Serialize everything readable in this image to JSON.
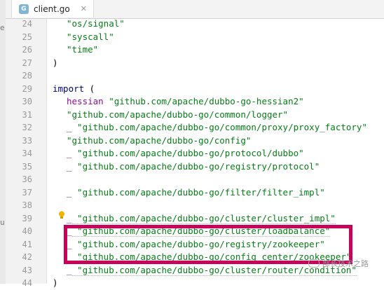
{
  "tab": {
    "filename": "client.go",
    "icon_name": "go-file-icon"
  },
  "editor": {
    "lines": [
      {
        "num": "24",
        "parts": [
          {
            "t": "\"os/signal\"",
            "c": "str"
          }
        ]
      },
      {
        "num": "25",
        "parts": [
          {
            "t": "\"syscall\"",
            "c": "str"
          }
        ]
      },
      {
        "num": "26",
        "parts": [
          {
            "t": "\"time\"",
            "c": "str"
          }
        ]
      },
      {
        "num": "27",
        "parts": [
          {
            "t": ")",
            "c": "punc"
          }
        ]
      },
      {
        "num": "28",
        "parts": []
      },
      {
        "num": "29",
        "parts": [
          {
            "t": "import",
            "c": "kw"
          },
          {
            "t": " (",
            "c": "punc"
          }
        ]
      },
      {
        "num": "30",
        "parts": [
          {
            "t": "hessian",
            "c": "alias"
          },
          {
            "t": " \"github.com/apache/dubbo-go-hessian2\"",
            "c": "str"
          }
        ]
      },
      {
        "num": "31",
        "parts": [
          {
            "t": "\"github.com/apache/dubbo-go/common/logger\"",
            "c": "str"
          }
        ]
      },
      {
        "num": "32",
        "parts": [
          {
            "t": "_",
            "c": "alias"
          },
          {
            "t": " \"github.com/apache/dubbo-go/common/proxy/proxy_factory\"",
            "c": "str"
          }
        ]
      },
      {
        "num": "33",
        "parts": [
          {
            "t": "\"github.com/apache/dubbo-go/config\"",
            "c": "str"
          }
        ]
      },
      {
        "num": "34",
        "parts": [
          {
            "t": "_",
            "c": "alias"
          },
          {
            "t": " \"github.com/apache/dubbo-go/protocol/dubbo\"",
            "c": "str"
          }
        ]
      },
      {
        "num": "35",
        "parts": [
          {
            "t": "_",
            "c": "alias"
          },
          {
            "t": " \"github.com/apache/dubbo-go/registry/protocol\"",
            "c": "str"
          }
        ]
      },
      {
        "num": "36",
        "parts": []
      },
      {
        "num": "37",
        "parts": [
          {
            "t": "_",
            "c": "alias"
          },
          {
            "t": " \"github.com/apache/dubbo-go/filter/filter_impl\"",
            "c": "str"
          }
        ]
      },
      {
        "num": "38",
        "parts": []
      },
      {
        "num": "39",
        "parts": [
          {
            "t": "_",
            "c": "alias"
          },
          {
            "t": " \"github.com/apache/dubbo-go/cluster/cluster_impl\"",
            "c": "str underline"
          }
        ]
      },
      {
        "num": "40",
        "parts": [
          {
            "t": "_",
            "c": "alias"
          },
          {
            "t": " \"github.com/apache/dubbo-go/cluster/loadbalance\"",
            "c": "str underline"
          }
        ]
      },
      {
        "num": "41",
        "parts": [
          {
            "t": "_",
            "c": "alias"
          },
          {
            "t": " \"github.com/apache/dubbo-go/registry/zookeeper\"",
            "c": "str"
          }
        ]
      },
      {
        "num": "42",
        "parts": [
          {
            "t": "_",
            "c": "alias"
          },
          {
            "t": " \"github.com/apache/dubbo-go/config_center/zookeeper\"",
            "c": "str underline"
          }
        ]
      },
      {
        "num": "43",
        "parts": [
          {
            "t": "_",
            "c": "alias"
          },
          {
            "t": " \"github.com/apache/dubbo-go/cluster/router/condition\"",
            "c": "str underline"
          }
        ]
      },
      {
        "num": "44",
        "parts": [
          {
            "t": ")",
            "c": "punc"
          }
        ]
      }
    ]
  },
  "left_strip": {
    "stubs": [
      "e",
      "ur"
    ]
  },
  "watermark": {
    "text": "部长技术之路"
  },
  "colors": {
    "highlight": "#c8005a",
    "string": "#067d17",
    "keyword": "#000080",
    "alias": "#871094"
  }
}
